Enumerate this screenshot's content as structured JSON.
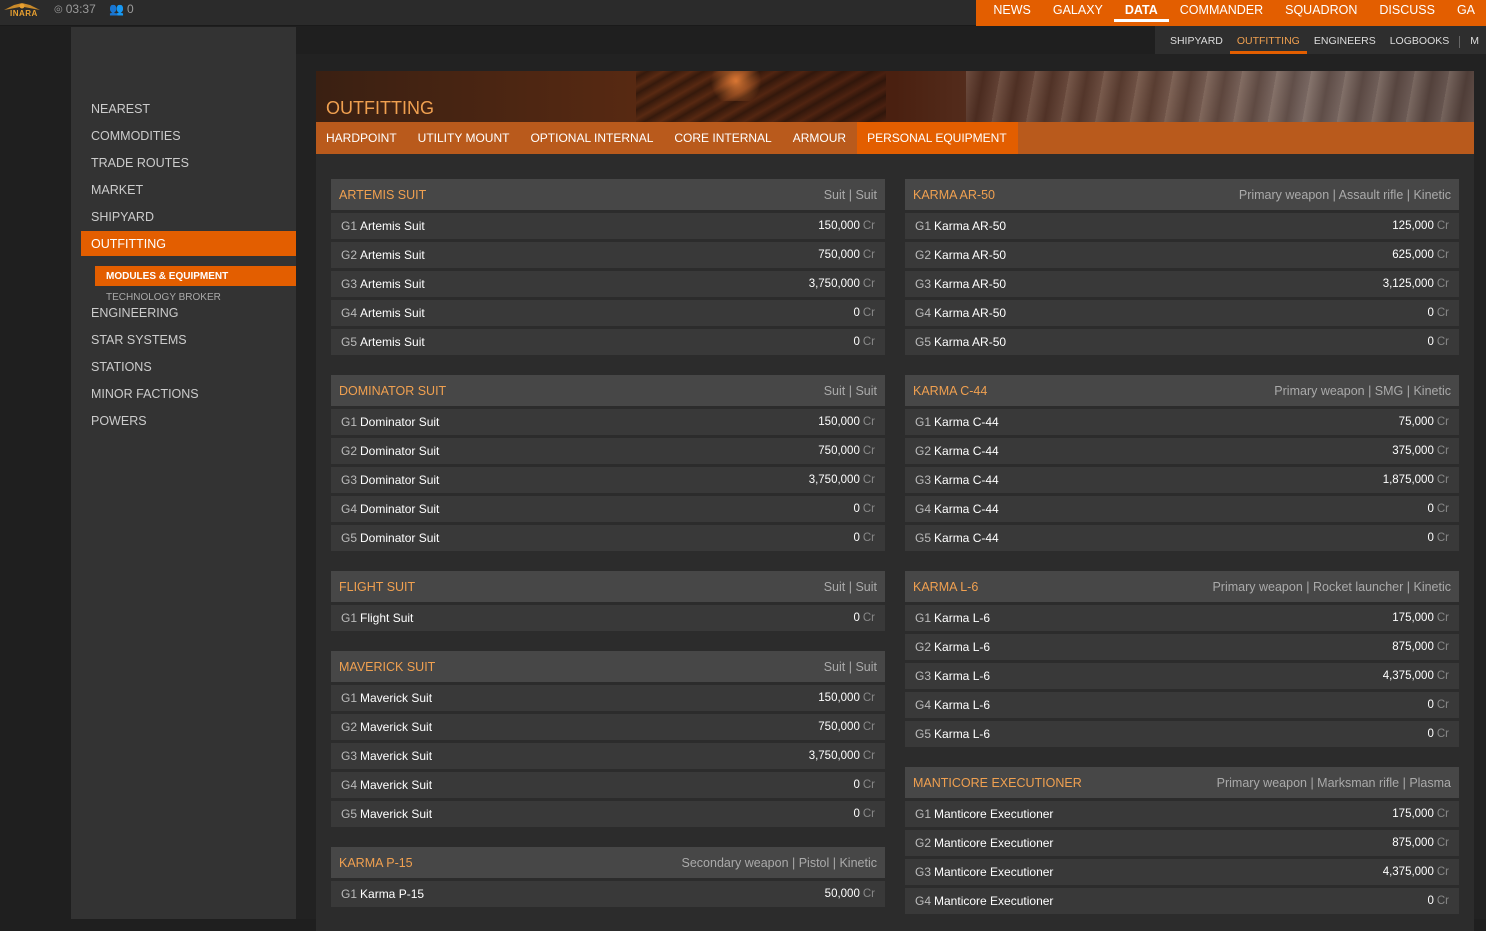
{
  "topbar": {
    "logo_text": "INARA",
    "time": "03:37",
    "online_count": "0",
    "nav": [
      "NEWS",
      "GALAXY",
      "DATA",
      "COMMANDER",
      "SQUADRON",
      "DISCUSS",
      "GA"
    ],
    "nav_active": 2,
    "subnav": [
      "SHIPYARD",
      "OUTFITTING",
      "ENGINEERS",
      "LOGBOOKS",
      "M"
    ],
    "subnav_active": 1
  },
  "sidebar": {
    "items": [
      "NEAREST",
      "COMMODITIES",
      "TRADE ROUTES",
      "MARKET",
      "SHIPYARD",
      "OUTFITTING",
      "ENGINEERING",
      "STAR SYSTEMS",
      "STATIONS",
      "MINOR FACTIONS",
      "POWERS"
    ],
    "active_index": 5,
    "sub_items": [
      "MODULES & EQUIPMENT",
      "TECHNOLOGY BROKER"
    ],
    "sub_active_index": 0
  },
  "page": {
    "title": "OUTFITTING",
    "tabs": [
      "HARDPOINT",
      "UTILITY MOUNT",
      "OPTIONAL INTERNAL",
      "CORE INTERNAL",
      "ARMOUR",
      "PERSONAL EQUIPMENT"
    ],
    "active_tab": 5,
    "currency": "Cr"
  },
  "left_column": [
    {
      "title": "ARTEMIS SUIT",
      "meta": "Suit | Suit",
      "rows": [
        {
          "grade": "G1",
          "name": "Artemis Suit",
          "price": "150,000"
        },
        {
          "grade": "G2",
          "name": "Artemis Suit",
          "price": "750,000"
        },
        {
          "grade": "G3",
          "name": "Artemis Suit",
          "price": "3,750,000"
        },
        {
          "grade": "G4",
          "name": "Artemis Suit",
          "price": "0"
        },
        {
          "grade": "G5",
          "name": "Artemis Suit",
          "price": "0"
        }
      ]
    },
    {
      "title": "DOMINATOR SUIT",
      "meta": "Suit | Suit",
      "rows": [
        {
          "grade": "G1",
          "name": "Dominator Suit",
          "price": "150,000"
        },
        {
          "grade": "G2",
          "name": "Dominator Suit",
          "price": "750,000"
        },
        {
          "grade": "G3",
          "name": "Dominator Suit",
          "price": "3,750,000"
        },
        {
          "grade": "G4",
          "name": "Dominator Suit",
          "price": "0"
        },
        {
          "grade": "G5",
          "name": "Dominator Suit",
          "price": "0"
        }
      ]
    },
    {
      "title": "FLIGHT SUIT",
      "meta": "Suit | Suit",
      "rows": [
        {
          "grade": "G1",
          "name": "Flight Suit",
          "price": "0"
        }
      ]
    },
    {
      "title": "MAVERICK SUIT",
      "meta": "Suit | Suit",
      "rows": [
        {
          "grade": "G1",
          "name": "Maverick Suit",
          "price": "150,000"
        },
        {
          "grade": "G2",
          "name": "Maverick Suit",
          "price": "750,000"
        },
        {
          "grade": "G3",
          "name": "Maverick Suit",
          "price": "3,750,000"
        },
        {
          "grade": "G4",
          "name": "Maverick Suit",
          "price": "0"
        },
        {
          "grade": "G5",
          "name": "Maverick Suit",
          "price": "0"
        }
      ]
    },
    {
      "title": "KARMA P-15",
      "meta": "Secondary weapon | Pistol | Kinetic",
      "rows": [
        {
          "grade": "G1",
          "name": "Karma P-15",
          "price": "50,000"
        }
      ]
    }
  ],
  "right_column": [
    {
      "title": "KARMA AR-50",
      "meta": "Primary weapon | Assault rifle | Kinetic",
      "rows": [
        {
          "grade": "G1",
          "name": "Karma AR-50",
          "price": "125,000"
        },
        {
          "grade": "G2",
          "name": "Karma AR-50",
          "price": "625,000"
        },
        {
          "grade": "G3",
          "name": "Karma AR-50",
          "price": "3,125,000"
        },
        {
          "grade": "G4",
          "name": "Karma AR-50",
          "price": "0"
        },
        {
          "grade": "G5",
          "name": "Karma AR-50",
          "price": "0"
        }
      ]
    },
    {
      "title": "KARMA C-44",
      "meta": "Primary weapon | SMG | Kinetic",
      "rows": [
        {
          "grade": "G1",
          "name": "Karma C-44",
          "price": "75,000"
        },
        {
          "grade": "G2",
          "name": "Karma C-44",
          "price": "375,000"
        },
        {
          "grade": "G3",
          "name": "Karma C-44",
          "price": "1,875,000"
        },
        {
          "grade": "G4",
          "name": "Karma C-44",
          "price": "0"
        },
        {
          "grade": "G5",
          "name": "Karma C-44",
          "price": "0"
        }
      ]
    },
    {
      "title": "KARMA L-6",
      "meta": "Primary weapon | Rocket launcher | Kinetic",
      "rows": [
        {
          "grade": "G1",
          "name": "Karma L-6",
          "price": "175,000"
        },
        {
          "grade": "G2",
          "name": "Karma L-6",
          "price": "875,000"
        },
        {
          "grade": "G3",
          "name": "Karma L-6",
          "price": "4,375,000"
        },
        {
          "grade": "G4",
          "name": "Karma L-6",
          "price": "0"
        },
        {
          "grade": "G5",
          "name": "Karma L-6",
          "price": "0"
        }
      ]
    },
    {
      "title": "MANTICORE EXECUTIONER",
      "meta": "Primary weapon | Marksman rifle | Plasma",
      "rows": [
        {
          "grade": "G1",
          "name": "Manticore Executioner",
          "price": "175,000"
        },
        {
          "grade": "G2",
          "name": "Manticore Executioner",
          "price": "875,000"
        },
        {
          "grade": "G3",
          "name": "Manticore Executioner",
          "price": "4,375,000"
        },
        {
          "grade": "G4",
          "name": "Manticore Executioner",
          "price": "0"
        }
      ]
    }
  ]
}
